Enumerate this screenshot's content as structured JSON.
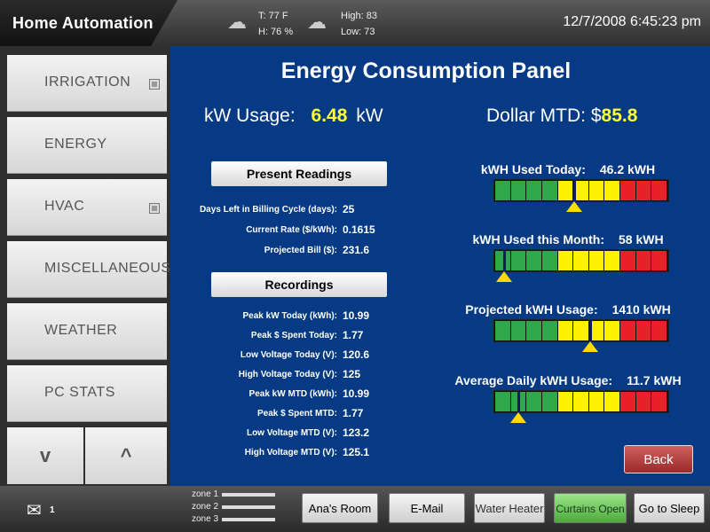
{
  "app": {
    "title": "Home Automation"
  },
  "weather": {
    "temp": "T:  77 F",
    "humidity": "H: 76 %",
    "high": "High: 83",
    "low": "Low: 73"
  },
  "clock": "12/7/2008 6:45:23 pm",
  "sidebar": {
    "items": [
      {
        "label": "IRRIGATION",
        "has_box": true
      },
      {
        "label": "ENERGY",
        "has_box": false
      },
      {
        "label": "HVAC",
        "has_box": true
      },
      {
        "label": "MISCELLANEOUS",
        "has_box": false
      },
      {
        "label": "WEATHER",
        "has_box": false
      },
      {
        "label": "PC STATS",
        "has_box": false
      }
    ],
    "down_label": "v",
    "up_label": "^"
  },
  "panel": {
    "title": "Energy Consumption Panel",
    "kw_label": "kW Usage:",
    "kw_value": "6.48",
    "kw_unit": "kW",
    "dollar_label": "Dollar MTD: $",
    "dollar_value": "85.8",
    "present_header": "Present Readings",
    "present": [
      {
        "label": "Days Left in Billing Cycle (days):",
        "value": "25"
      },
      {
        "label": "Current Rate ($/kWh):",
        "value": "0.1615"
      },
      {
        "label": "Projected Bill ($):",
        "value": "231.6"
      }
    ],
    "recordings_header": "Recordings",
    "recordings": [
      {
        "label": "Peak kW Today (kWh):",
        "value": "10.99"
      },
      {
        "label": "Peak $ Spent Today:",
        "value": "1.77"
      },
      {
        "label": "Low Voltage Today (V):",
        "value": "120.6"
      },
      {
        "label": "High Voltage Today (V):",
        "value": "125"
      },
      {
        "label": "Peak kW MTD (kWh):",
        "value": "10.99"
      },
      {
        "label": "Peak $ Spent MTD:",
        "value": "1.77"
      },
      {
        "label": "Low Voltage MTD (V):",
        "value": "123.2"
      },
      {
        "label": "High Voltage MTD (V):",
        "value": "125.1"
      }
    ],
    "meters": [
      {
        "label": "kWH Used Today:",
        "value": "46.2 kWH",
        "level": 0.46
      },
      {
        "label": "kWH Used this Month:",
        "value": "58 kWH",
        "level": 0.06
      },
      {
        "label": "Projected kWH Usage:",
        "value": "1410 kWH",
        "level": 0.55
      },
      {
        "label": "Average Daily kWH Usage:",
        "value": "11.7  kWH",
        "level": 0.14
      }
    ],
    "back_label": "Back"
  },
  "colors": {
    "green": "#2ea84a",
    "yellow": "#fff200",
    "red": "#e8202a",
    "panel": "#063a85"
  },
  "bottom": {
    "mail_count": "1",
    "zones": [
      "zone 1",
      "zone 2",
      "zone 3"
    ],
    "buttons": [
      "Ana's Room",
      "E-Mail",
      "Water Heater",
      "Curtains Open",
      "Go to Sleep"
    ]
  }
}
